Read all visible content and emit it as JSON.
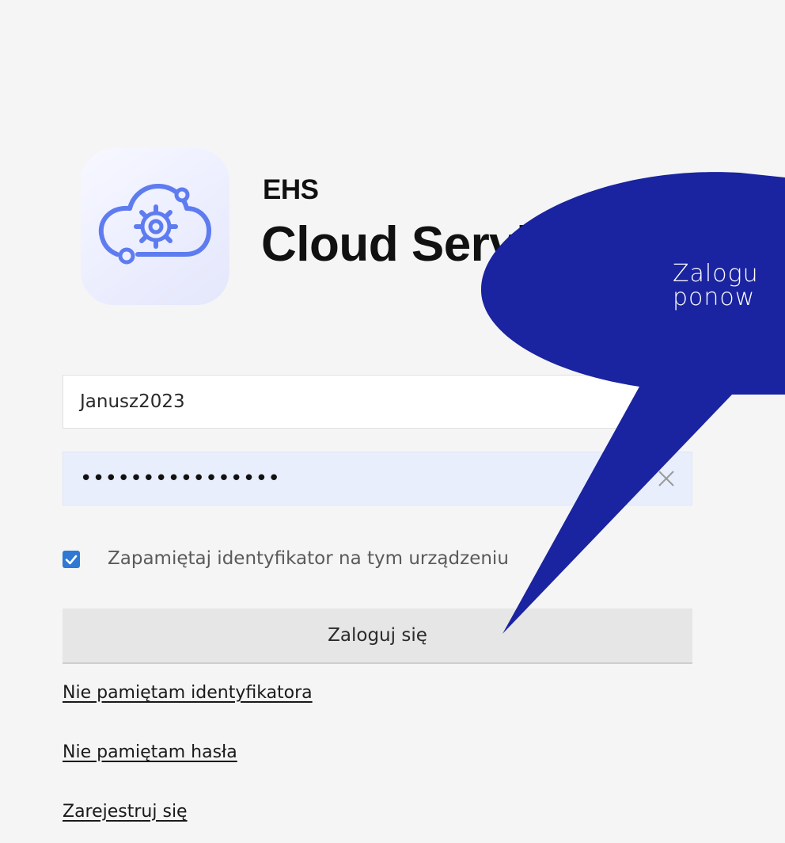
{
  "brand": {
    "title_small": "EHS",
    "title_large": "Cloud Service",
    "logo_icon": "cloud-gear-icon"
  },
  "form": {
    "username_value": "Janusz2023",
    "password_value": "••••••••••••••••",
    "clear_icon": "close-icon",
    "remember_checked": true,
    "remember_label": "Zapamiętaj identyfikator na tym urządzeniu",
    "login_label": "Zaloguj się"
  },
  "links": {
    "forgot_id": "Nie pamiętam identyfikatora",
    "forgot_password": "Nie pamiętam hasła",
    "register": "Zarejestruj się"
  },
  "callout": {
    "line1": "Zalogu",
    "line2": "ponow",
    "color": "#1a23a0"
  }
}
